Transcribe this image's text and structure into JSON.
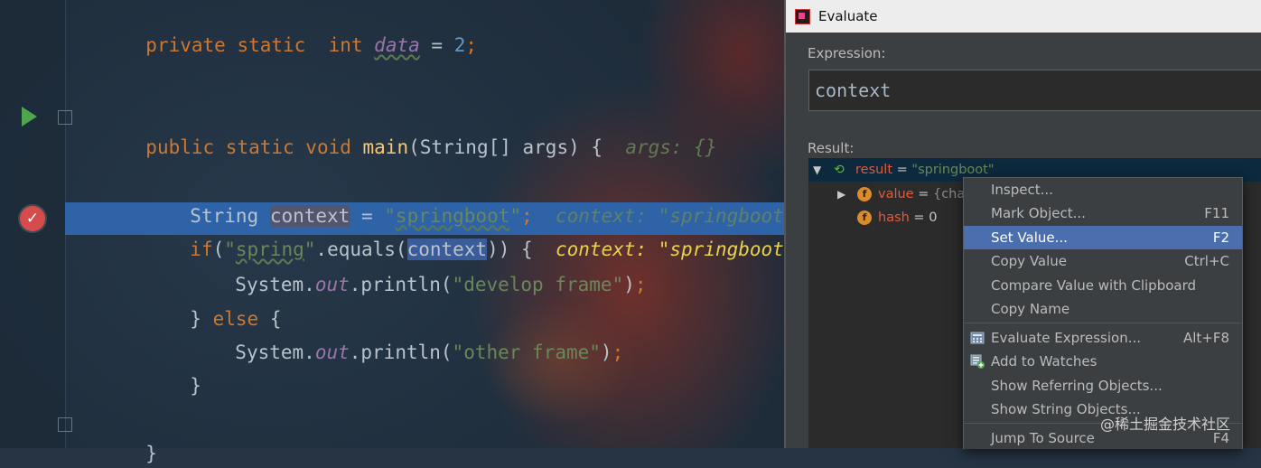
{
  "editor": {
    "line1": {
      "kw": "private static  int ",
      "field": "data",
      "eq": " = ",
      "num": "2",
      "semi": ";"
    },
    "line2": {
      "kw": "public static void ",
      "fn": "main",
      "sig": "(String[] args) {  ",
      "hint": "args: {}"
    },
    "line3": {
      "type": "String ",
      "var": "context",
      "eq": " = ",
      "str_open": "\"",
      "str_word": "springboot",
      "str_close": "\"",
      "semi": ";  ",
      "hint": "context: \"springboot\""
    },
    "line4": {
      "kw": "if",
      "paren": "(",
      "str_open": "\"",
      "str_word": "spring",
      "str_close": "\"",
      "call": ".equals(",
      "arg": "context",
      "close": ")) {  ",
      "hint": "context: \"springboot\""
    },
    "line5": {
      "cls": "System.",
      "field": "out",
      "call": ".println(",
      "str": "\"develop frame\"",
      "close": ")",
      "semi": ";"
    },
    "line6": {
      "brace": "} ",
      "kw": "else",
      "rest": " {"
    },
    "line7": {
      "cls": "System.",
      "field": "out",
      "call": ".println(",
      "str": "\"other frame\"",
      "close": ")",
      "semi": ";"
    },
    "line8": {
      "brace": "}"
    },
    "line9": {
      "brace": "}"
    }
  },
  "dialog": {
    "title": "Evaluate",
    "expression_label": "Expression:",
    "expression_value": "context",
    "result_label": "Result:",
    "result_row": {
      "name": "result",
      "eq": " = ",
      "value": "\"springboot\""
    },
    "children": [
      {
        "name": "value",
        "eq": " = ",
        "value": "{char"
      },
      {
        "name": "hash",
        "eq": " = ",
        "value": "0"
      }
    ]
  },
  "context_menu": {
    "items": [
      {
        "label": "Inspect...",
        "shortcut": ""
      },
      {
        "label": "Mark Object...",
        "shortcut": "F11"
      },
      {
        "label": "Set Value...",
        "shortcut": "F2"
      },
      {
        "label": "Copy Value",
        "shortcut": "Ctrl+C"
      },
      {
        "label": "Compare Value with Clipboard",
        "shortcut": ""
      },
      {
        "label": "Copy Name",
        "shortcut": ""
      },
      {
        "label": "Evaluate Expression...",
        "shortcut": "Alt+F8"
      },
      {
        "label": "Add to Watches",
        "shortcut": ""
      },
      {
        "label": "Show Referring Objects...",
        "shortcut": ""
      },
      {
        "label": "Show String Objects...",
        "shortcut": ""
      },
      {
        "label": "Jump To Source",
        "shortcut": "F4"
      }
    ],
    "selected_index": 2
  },
  "watermark": "@稀土掘金技术社区",
  "colors": {
    "selection": "#4b6eaf",
    "highlight_line": "#2e63a8",
    "breakpoint": "#d64b4b",
    "run": "#4fa54c"
  }
}
